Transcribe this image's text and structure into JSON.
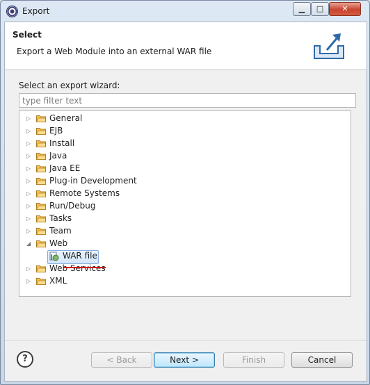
{
  "window": {
    "title": "Export",
    "controls": {
      "minimize": "▁",
      "maximize": "□",
      "close": "✕"
    }
  },
  "header": {
    "title": "Select",
    "description": "Export a Web Module into an external WAR file"
  },
  "wizard": {
    "label": "Select an export wizard:",
    "filter_placeholder": "type filter text",
    "filter_value": "",
    "tree": [
      {
        "label": "General",
        "expanded": false
      },
      {
        "label": "EJB",
        "expanded": false
      },
      {
        "label": "Install",
        "expanded": false
      },
      {
        "label": "Java",
        "expanded": false
      },
      {
        "label": "Java EE",
        "expanded": false
      },
      {
        "label": "Plug-in Development",
        "expanded": false
      },
      {
        "label": "Remote Systems",
        "expanded": false
      },
      {
        "label": "Run/Debug",
        "expanded": false
      },
      {
        "label": "Tasks",
        "expanded": false
      },
      {
        "label": "Team",
        "expanded": false
      },
      {
        "label": "Web",
        "expanded": true
      },
      {
        "label": "Web Services",
        "expanded": false
      },
      {
        "label": "XML",
        "expanded": false
      }
    ],
    "selected_child": {
      "label": "WAR file",
      "parent": "Web"
    }
  },
  "buttons": {
    "help": "?",
    "back": "< Back",
    "next": "Next >",
    "finish": "Finish",
    "cancel": "Cancel"
  },
  "icons": {
    "folder": "folder-icon",
    "war": "war-file-icon",
    "export": "export-wizard-icon",
    "help": "help-icon"
  },
  "colors": {
    "selection": "#d4e6fb",
    "annotation_underline": "#d21a1a",
    "folder": "#f4c25a"
  }
}
